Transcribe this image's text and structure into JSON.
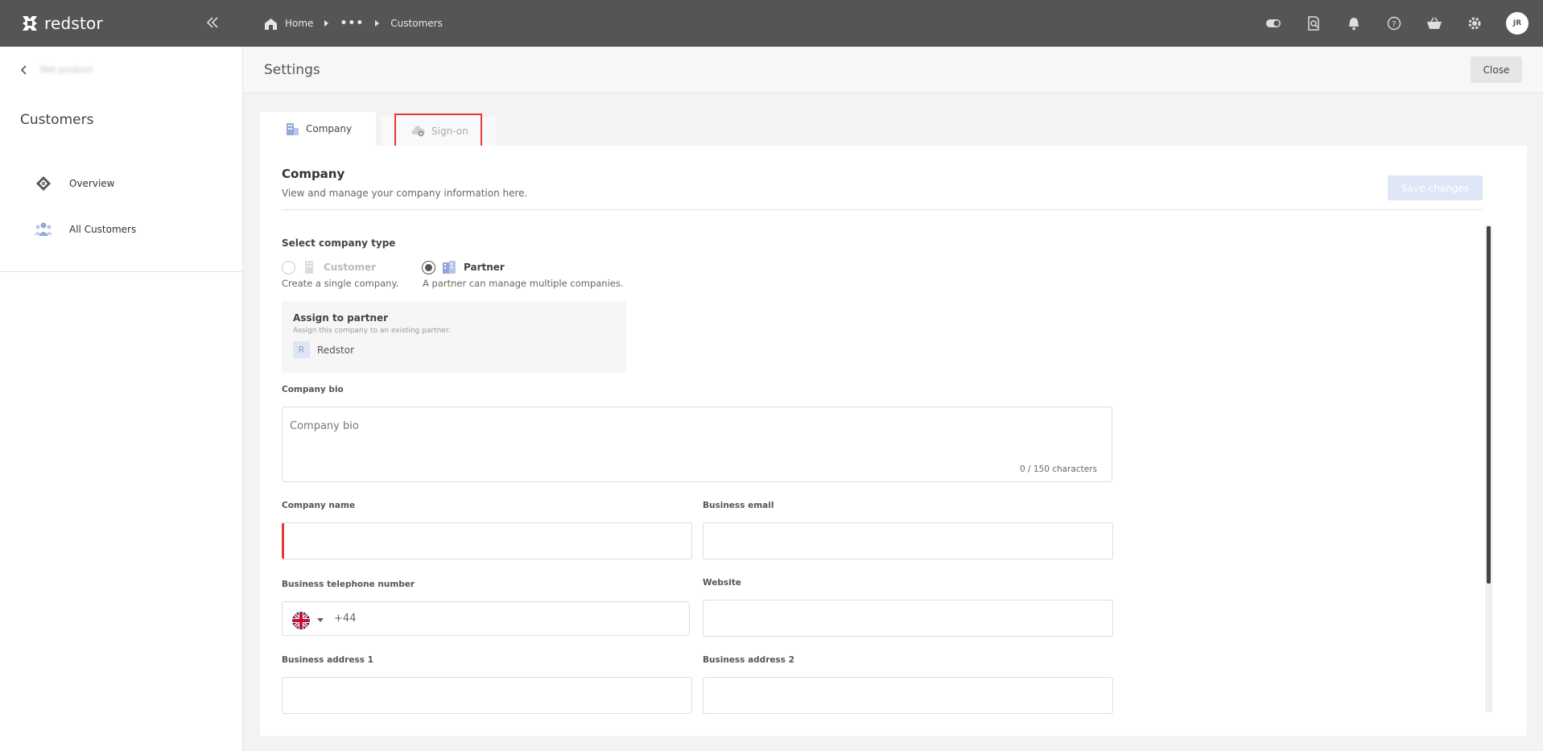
{
  "brand": {
    "name": "redstor"
  },
  "breadcrumb": {
    "home": "Home",
    "ellipsis": "•••",
    "current": "Customers"
  },
  "topbar": {
    "icons": [
      "toggle-icon",
      "search-doc-icon",
      "bell-icon",
      "help-icon",
      "basket-icon",
      "gear-icon"
    ],
    "avatar_initials": "JR"
  },
  "sidebar": {
    "back_text": "Net product",
    "title": "Customers",
    "items": [
      {
        "label": "Overview",
        "icon": "overview-icon"
      },
      {
        "label": "All Customers",
        "icon": "people-icon"
      }
    ]
  },
  "header": {
    "title": "Settings",
    "close_label": "Close"
  },
  "tabs": [
    {
      "label": "Company",
      "icon": "building-icon",
      "active": true
    },
    {
      "label": "Sign-on",
      "icon": "cloud-lock-icon",
      "active": false
    }
  ],
  "company": {
    "title": "Company",
    "subtitle": "View and manage your company information here.",
    "save_label": "Save changes",
    "company_type_label": "Select company type",
    "types": [
      {
        "label": "Customer",
        "description": "Create a single company.",
        "selected": false
      },
      {
        "label": "Partner",
        "description": "A partner can manage multiple companies.",
        "selected": true
      }
    ],
    "assign": {
      "title": "Assign to partner",
      "subtitle": "Assign this company to an existing partner.",
      "initial": "R",
      "partner": "Redstor"
    },
    "bio": {
      "label": "Company bio",
      "placeholder": "Company bio",
      "counter": "0 / 150 characters"
    },
    "fields": {
      "company_name": {
        "label": "Company name",
        "value": ""
      },
      "business_email": {
        "label": "Business email",
        "value": ""
      },
      "telephone": {
        "label": "Business telephone number",
        "country_code": "+44",
        "value": ""
      },
      "website": {
        "label": "Website",
        "value": ""
      },
      "address1": {
        "label": "Business address 1",
        "value": ""
      },
      "address2": {
        "label": "Business address 2",
        "value": ""
      }
    }
  },
  "colors": {
    "topbar": "#555555",
    "highlight": "#e23a3a",
    "accent": "#5b7fcf",
    "save_disabled": "#dfe6f6"
  }
}
